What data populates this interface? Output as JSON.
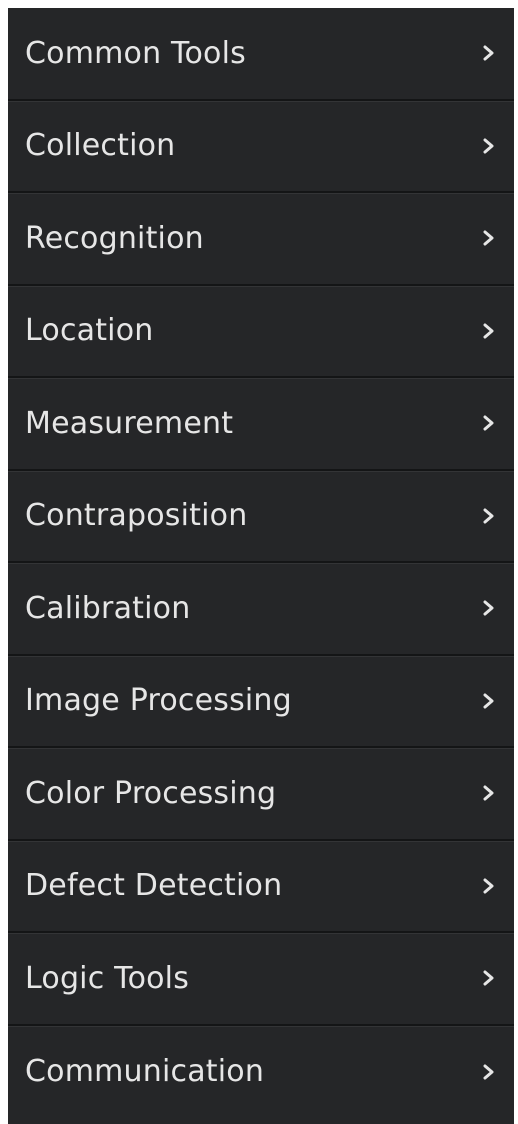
{
  "menu": {
    "items": [
      {
        "label": "Common Tools",
        "icon": "chevron-right-icon"
      },
      {
        "label": "Collection",
        "icon": "chevron-right-icon"
      },
      {
        "label": "Recognition",
        "icon": "chevron-right-icon"
      },
      {
        "label": "Location",
        "icon": "chevron-right-icon"
      },
      {
        "label": "Measurement",
        "icon": "chevron-right-icon"
      },
      {
        "label": "Contraposition",
        "icon": "chevron-right-icon"
      },
      {
        "label": "Calibration",
        "icon": "chevron-right-icon"
      },
      {
        "label": "Image Processing",
        "icon": "chevron-right-icon"
      },
      {
        "label": "Color Processing",
        "icon": "chevron-right-icon"
      },
      {
        "label": "Defect Detection",
        "icon": "chevron-right-icon"
      },
      {
        "label": "Logic Tools",
        "icon": "chevron-right-icon"
      },
      {
        "label": "Communication",
        "icon": "chevron-right-icon"
      }
    ]
  },
  "colors": {
    "panel_background": "#252628",
    "label_text": "#e6e6e6",
    "divider": "#141516",
    "chevron": "#e6e6e6"
  }
}
